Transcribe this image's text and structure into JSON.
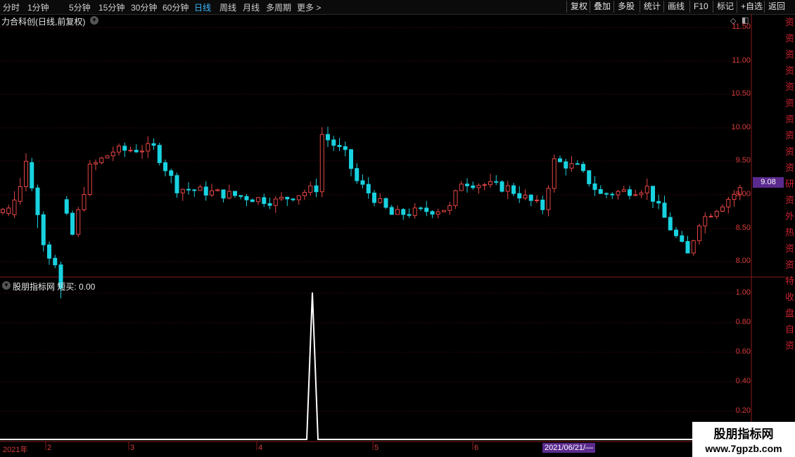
{
  "toolbar": {
    "periods": [
      "分时",
      "1分钟",
      "5分钟",
      "15分钟",
      "30分钟",
      "60分钟",
      "日线",
      "周线",
      "月线",
      "多周期",
      "更多 >"
    ],
    "active_period": "日线",
    "actions": [
      "复权",
      "叠加",
      "多股",
      "统计",
      "画线",
      "F10",
      "标记",
      "+自选",
      "返回"
    ]
  },
  "main_chart": {
    "title": "力合科创(日线,前复权)",
    "current_price": "9.08",
    "y_ticks": [
      "11.50",
      "11.00",
      "10.50",
      "10.00",
      "9.50",
      "9.00",
      "8.50",
      "8.00"
    ],
    "up_color": "#e64545",
    "down_color": "#19d2e0"
  },
  "indicator": {
    "title": "股朋指标网 短买: 0.00",
    "y_ticks": [
      "1.00",
      "0.80",
      "0.60",
      "0.40",
      "0.20"
    ]
  },
  "time_axis": {
    "labels": [
      "2021年",
      "2",
      "3",
      "4",
      "5",
      "6"
    ],
    "cursor_date": "2021/06/21/—"
  },
  "watermark": {
    "title": "股朋指标网",
    "url": "www.7gpzb.com"
  },
  "side_strip_text": "资资资资资资资资资资研资外热资资特收盘自资",
  "chart_data": {
    "type": "candlestick",
    "title": "力合科创(日线,前复权)",
    "ylim": [
      7.8,
      11.65
    ],
    "series": [
      {
        "o": 8.73,
        "c": 8.78,
        "h": 8.8,
        "l": 8.7
      },
      {
        "o": 8.72,
        "c": 8.8,
        "h": 8.85,
        "l": 8.68
      },
      {
        "o": 8.7,
        "c": 8.92,
        "h": 9.05,
        "l": 8.65
      },
      {
        "o": 8.9,
        "c": 9.12,
        "h": 9.25,
        "l": 8.85
      },
      {
        "o": 9.12,
        "c": 9.5,
        "h": 9.62,
        "l": 9.05
      },
      {
        "o": 9.48,
        "c": 9.1,
        "h": 9.55,
        "l": 9.05
      },
      {
        "o": 9.1,
        "c": 8.7,
        "h": 9.15,
        "l": 8.5
      },
      {
        "o": 8.7,
        "c": 8.25,
        "h": 8.75,
        "l": 8.15
      },
      {
        "o": 8.25,
        "c": 8.05,
        "h": 8.3,
        "l": 7.95
      },
      {
        "o": 8.05,
        "c": 7.95,
        "h": 8.1,
        "l": 7.9
      },
      {
        "o": 7.95,
        "c": 7.6,
        "h": 8.0,
        "l": 7.45
      }
    ]
  }
}
